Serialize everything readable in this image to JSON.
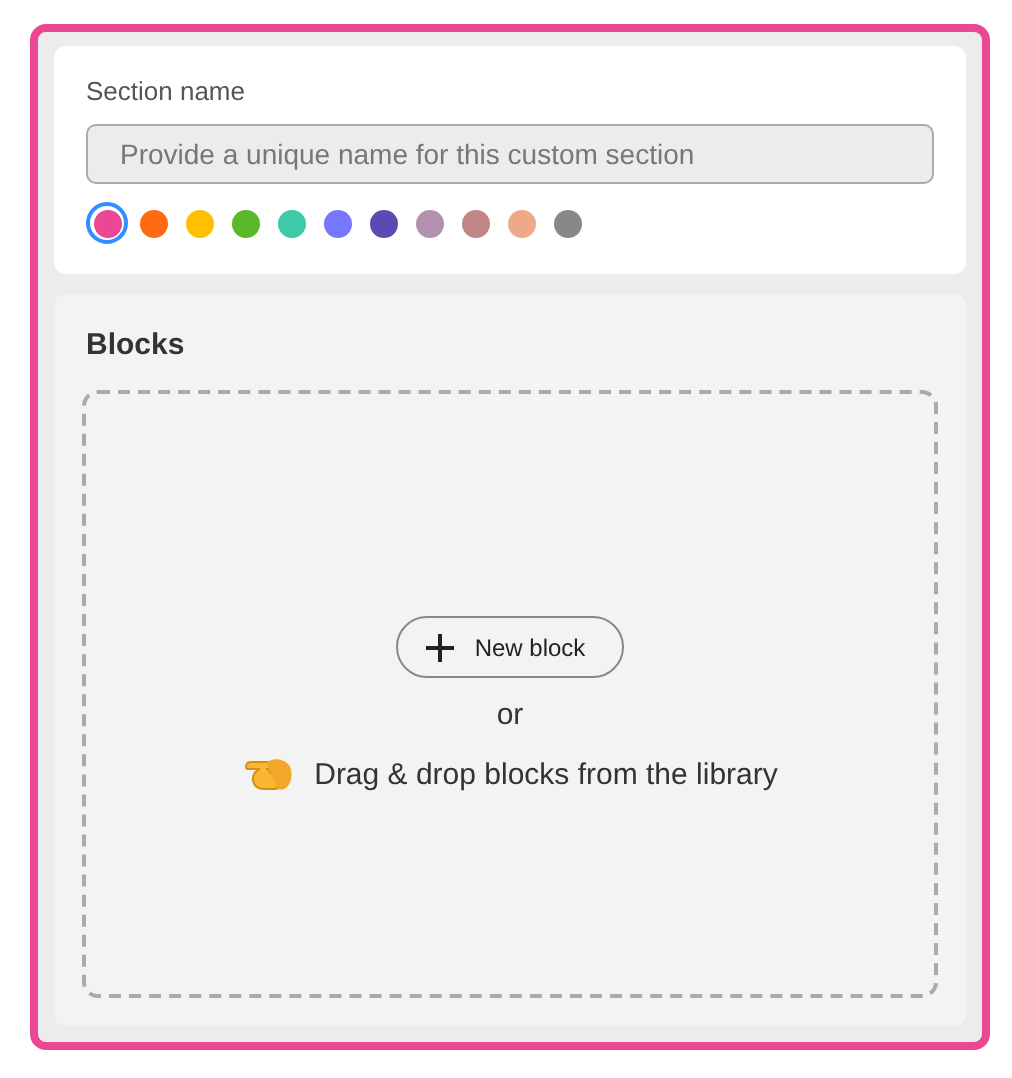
{
  "section_name": {
    "label": "Section name",
    "placeholder": "Provide a unique name for this custom section"
  },
  "colors": [
    {
      "color": "#ec4793",
      "selected": true
    },
    {
      "color": "#ff6a13",
      "selected": false
    },
    {
      "color": "#ffc000",
      "selected": false
    },
    {
      "color": "#5ab82a",
      "selected": false
    },
    {
      "color": "#3ec9a7",
      "selected": false
    },
    {
      "color": "#7577ff",
      "selected": false
    },
    {
      "color": "#5a4ab5",
      "selected": false
    },
    {
      "color": "#b390ad",
      "selected": false
    },
    {
      "color": "#c08683",
      "selected": false
    },
    {
      "color": "#eeaa88",
      "selected": false
    },
    {
      "color": "#888888",
      "selected": false
    }
  ],
  "blocks": {
    "title": "Blocks",
    "new_block_button": "New block",
    "or": "or",
    "drag_hint": "Drag & drop blocks from the library"
  }
}
